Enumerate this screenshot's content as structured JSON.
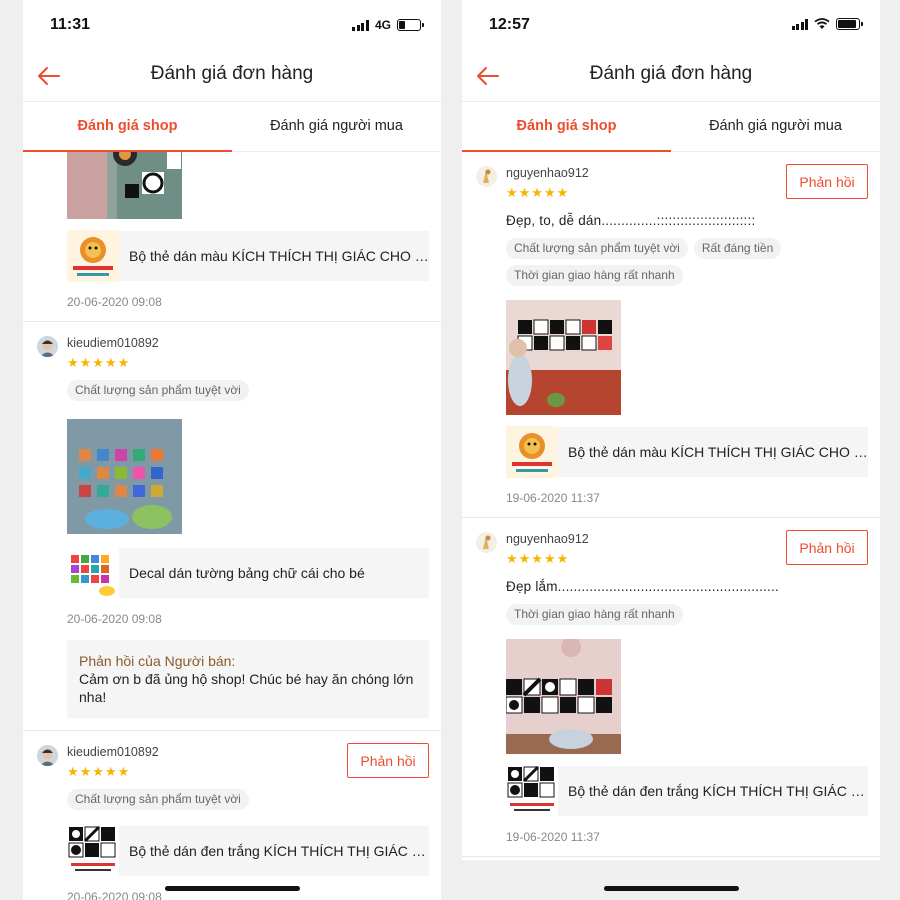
{
  "left": {
    "status_time": "11:31",
    "network": "4G",
    "title": "Đánh giá đơn hàng",
    "tabs": [
      "Đánh giá shop",
      "Đánh giá người mua"
    ],
    "partial_review": {
      "product": "Bộ thẻ dán màu KÍCH THÍCH THỊ GIÁC CHO BÉ",
      "date": "20-06-2020 09:08"
    },
    "reviews": [
      {
        "username": "kieudiem010892",
        "stars": "★★★★★",
        "tags": [
          "Chất lượng sản phẩm tuyệt vời"
        ],
        "product": "Decal dán tường bảng chữ cái cho bé",
        "date": "20-06-2020 09:08",
        "seller_reply_label": "Phản hồi của Người bán:",
        "seller_reply_text": "Cảm ơn b đã ủng hộ shop! Chúc bé hay ăn chóng lớn nha!"
      },
      {
        "username": "kieudiem010892",
        "stars": "★★★★★",
        "reply_label": "Phản hồi",
        "tags": [
          "Chất lượng sản phẩm tuyệt vời"
        ],
        "product": "Bộ thẻ dán đen trắng KÍCH THÍCH THỊ GIÁC CHO BÉ",
        "date": "20-06-2020 09:08"
      }
    ]
  },
  "right": {
    "status_time": "12:57",
    "title": "Đánh giá đơn hàng",
    "tabs": [
      "Đánh giá shop",
      "Đánh giá người mua"
    ],
    "reviews": [
      {
        "username": "nguyenhao912",
        "stars": "★★★★★",
        "reply_label": "Phản hồi",
        "text": "Đẹp, to, dễ dán..............:::::::::::::::::::::::::",
        "tags": [
          "Chất lượng sản phẩm tuyệt vời",
          "Rất đáng tiền",
          "Thời gian giao hàng rất nhanh"
        ],
        "product": "Bộ thẻ dán màu KÍCH THÍCH THỊ GIÁC CHO BÉ",
        "date": "19-06-2020 11:37"
      },
      {
        "username": "nguyenhao912",
        "stars": "★★★★★",
        "reply_label": "Phản hồi",
        "text": "Đẹp lắm........................................................",
        "tags": [
          "Thời gian giao hàng rất nhanh"
        ],
        "product": "Bộ thẻ dán đen trắng KÍCH THÍCH THỊ GIÁC CHO BÉ",
        "date": "19-06-2020 11:37"
      }
    ]
  },
  "colors": {
    "accent": "#ee4d2d",
    "star": "#f7b500",
    "seller_label": "#8b5a2b"
  }
}
